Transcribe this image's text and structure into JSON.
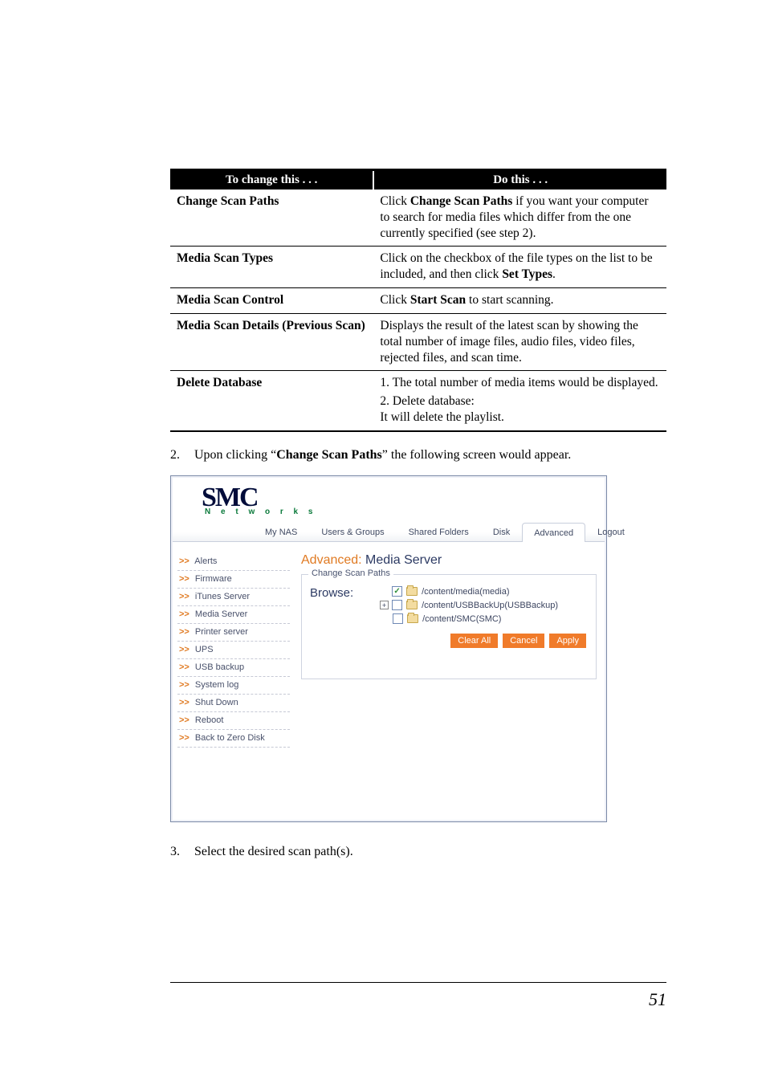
{
  "table": {
    "headers": {
      "left": "To change this . . .",
      "right": "Do this . . ."
    },
    "rows": [
      {
        "left": "Change Scan Paths",
        "right_pre": "Click ",
        "right_bold": "Change Scan Paths",
        "right_post": " if you want your computer to search for media files which differ from the one currently specified (see step 2)."
      },
      {
        "left": "Media Scan Types",
        "right_pre": "Click on the checkbox of the file types on the list to be included, and then click ",
        "right_bold": "Set Types",
        "right_post": "."
      },
      {
        "left": "Media Scan Control",
        "right_pre": "Click ",
        "right_bold": "Start Scan",
        "right_post": " to start scanning."
      },
      {
        "left": "Media Scan Details (Previous Scan)",
        "right_plain": "Displays the result of the latest scan by showing the total number of image files, audio files, video files, rejected files, and scan time."
      },
      {
        "left": "Delete Database",
        "right_lines": [
          "1. The total number of media items would be displayed.",
          "2. Delete database:",
          "It will delete the playlist."
        ]
      }
    ]
  },
  "step2": {
    "num": "2.",
    "pre": "Upon clicking “",
    "bold": "Change Scan Paths",
    "post": "” the following screen would appear."
  },
  "shot": {
    "logo_main": "SMC",
    "logo_sub": "N e t w o r k s",
    "tabs": [
      "My NAS",
      "Users & Groups",
      "Shared Folders",
      "Disk",
      "Advanced",
      "Logout"
    ],
    "sidebar": [
      "Alerts",
      "Firmware",
      "iTunes Server",
      "Media Server",
      "Printer server",
      "UPS",
      "USB backup",
      "System log",
      "Shut Down",
      "Reboot",
      "Back to Zero Disk"
    ],
    "arrow": ">>",
    "title_adv": "Advanced:",
    "title_rest": " Media Server",
    "fieldset_legend": "Change Scan Paths",
    "browse_label": "Browse:",
    "tree": [
      {
        "checked": true,
        "expander": "",
        "indent": 0,
        "path": "/content/media(media)"
      },
      {
        "checked": false,
        "expander": "+",
        "indent": 0,
        "path": "/content/USBBackUp(USBBackup)"
      },
      {
        "checked": false,
        "expander": "",
        "indent": 1,
        "path": "/content/SMC(SMC)"
      }
    ],
    "buttons": [
      "Clear All",
      "Cancel",
      "Apply"
    ]
  },
  "step3": {
    "num": "3.",
    "text": "Select the desired scan path(s)."
  },
  "page_number": "51",
  "chart_data": {
    "type": "table",
    "columns": [
      "To change this . . .",
      "Do this . . ."
    ],
    "rows": [
      [
        "Change Scan Paths",
        "Click Change Scan Paths if you want your computer to search for media files which differ from the one currently specified (see step 2)."
      ],
      [
        "Media Scan Types",
        "Click on the checkbox of the file types on the list to be included, and then click Set Types."
      ],
      [
        "Media Scan Control",
        "Click Start Scan to start scanning."
      ],
      [
        "Media Scan Details (Previous Scan)",
        "Displays the result of the latest scan by showing the total number of image files, audio files, video files, rejected files, and scan time."
      ],
      [
        "Delete Database",
        "1. The total number of media items would be displayed. 2. Delete database: It will delete the playlist."
      ]
    ]
  }
}
